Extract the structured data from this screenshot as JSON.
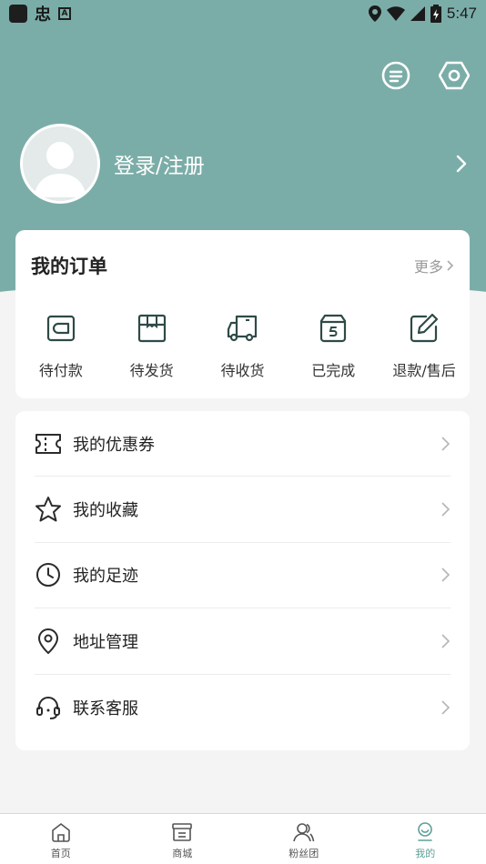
{
  "status_bar": {
    "time": "5:47",
    "badge_letter": "A",
    "app_glyph": "忠"
  },
  "profile": {
    "login_label": "登录/注册"
  },
  "orders": {
    "title": "我的订单",
    "more_label": "更多",
    "items": [
      {
        "label": "待付款",
        "icon": "wallet-icon"
      },
      {
        "label": "待发货",
        "icon": "package-icon"
      },
      {
        "label": "待收货",
        "icon": "truck-icon"
      },
      {
        "label": "已完成",
        "icon": "box-done-icon"
      },
      {
        "label": "退款/售后",
        "icon": "edit-icon"
      }
    ]
  },
  "menu": {
    "items": [
      {
        "label": "我的优惠券",
        "icon": "coupon-icon"
      },
      {
        "label": "我的收藏",
        "icon": "star-icon"
      },
      {
        "label": "我的足迹",
        "icon": "clock-icon"
      },
      {
        "label": "地址管理",
        "icon": "location-icon"
      },
      {
        "label": "联系客服",
        "icon": "headset-icon"
      }
    ]
  },
  "bottom_nav": {
    "items": [
      {
        "label": "首页",
        "icon": "home-icon"
      },
      {
        "label": "商城",
        "icon": "store-icon"
      },
      {
        "label": "粉丝团",
        "icon": "fans-icon"
      },
      {
        "label": "我的",
        "icon": "profile-icon",
        "active": true
      }
    ]
  },
  "colors": {
    "header": "#7bada8",
    "accent": "#5f9f98",
    "icon_dark": "#2e4a47"
  }
}
